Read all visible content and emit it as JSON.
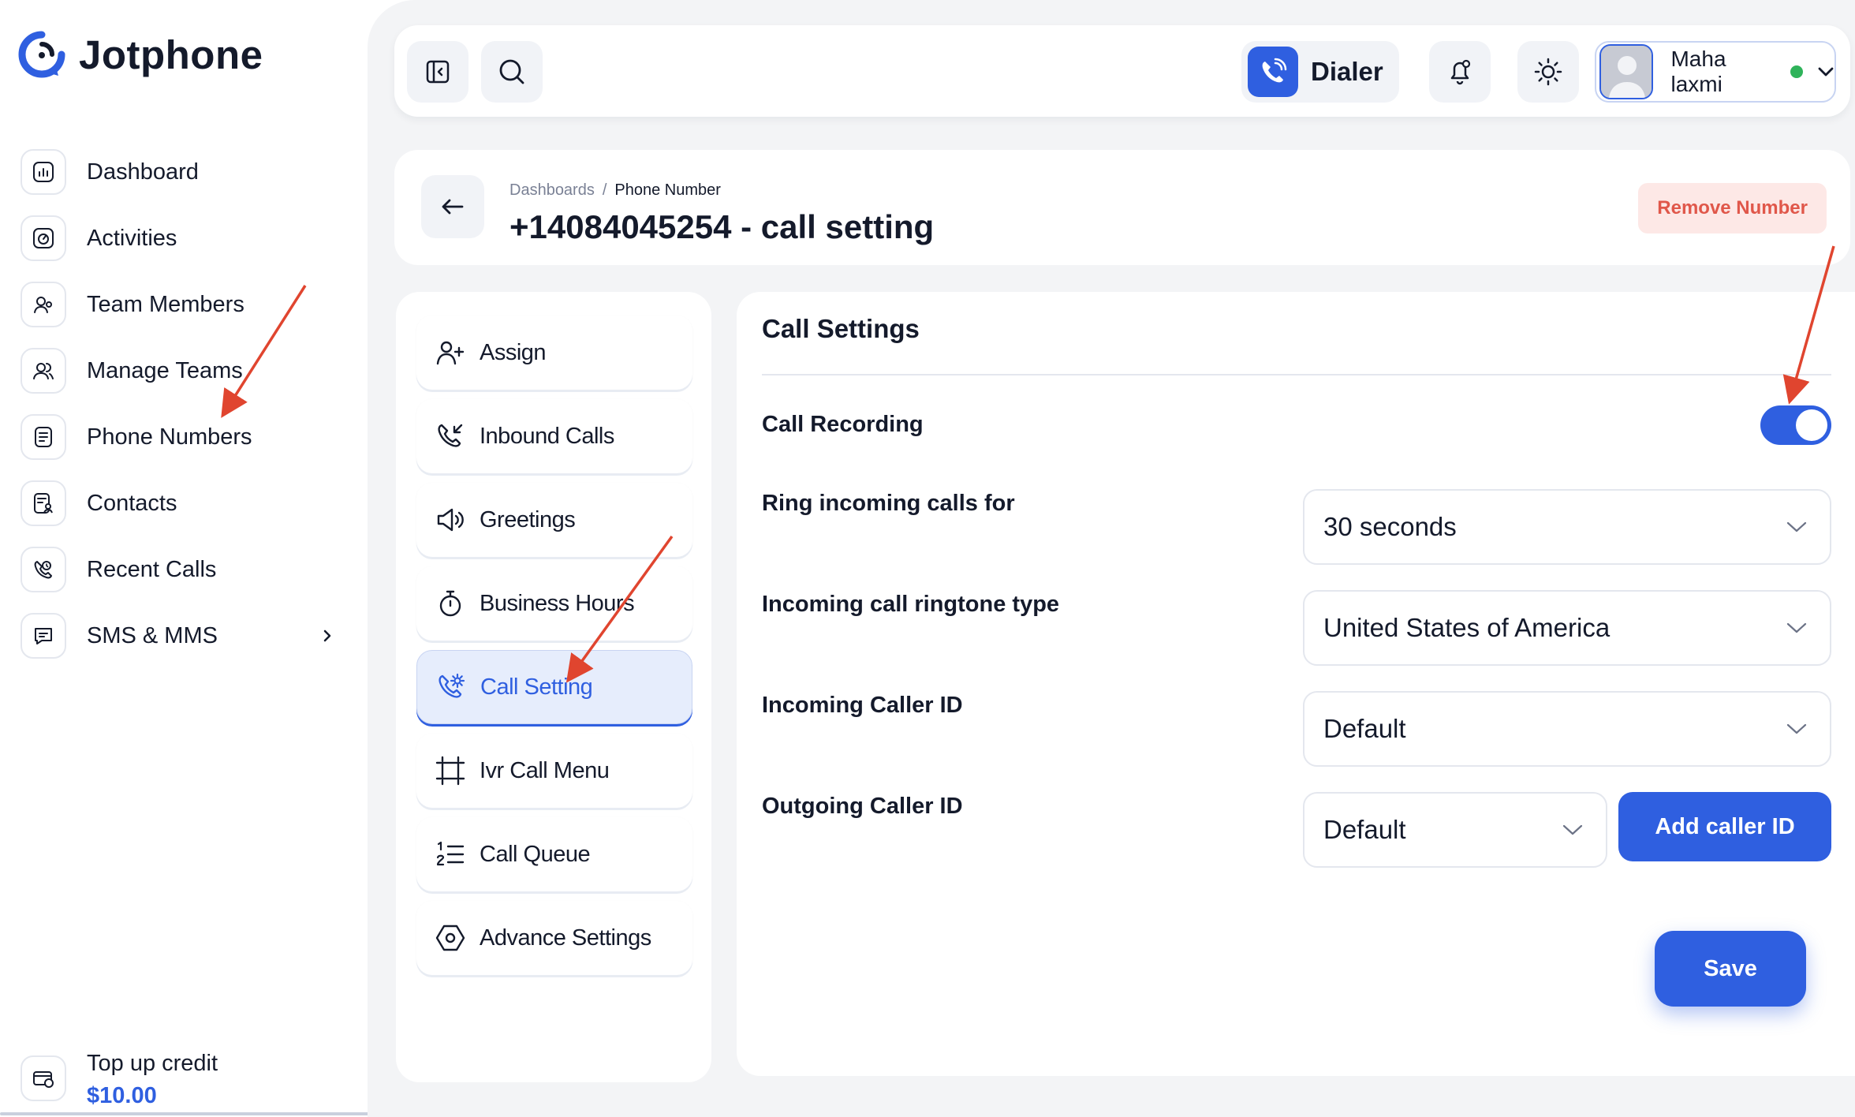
{
  "app": {
    "name": "Jotphone"
  },
  "sidebar": {
    "items": [
      {
        "label": "Dashboard",
        "icon": "chart-icon"
      },
      {
        "label": "Activities",
        "icon": "activity-icon"
      },
      {
        "label": "Team Members",
        "icon": "team-member-icon"
      },
      {
        "label": "Manage Teams",
        "icon": "teams-icon"
      },
      {
        "label": "Phone Numbers",
        "icon": "phone-book-icon"
      },
      {
        "label": "Contacts",
        "icon": "contacts-icon"
      },
      {
        "label": "Recent Calls",
        "icon": "recent-calls-icon"
      },
      {
        "label": "SMS & MMS",
        "icon": "message-icon"
      }
    ],
    "credit": {
      "label": "Top up credit",
      "value": "$10.00"
    }
  },
  "topbar": {
    "dialer_label": "Dialer",
    "user_name": "Maha laxmi",
    "status": "online"
  },
  "header": {
    "breadcrumb": [
      "Dashboards",
      "/",
      "Phone Number"
    ],
    "title": "+14084045254 - call setting",
    "remove_label": "Remove Number"
  },
  "submenu": {
    "items": [
      {
        "label": "Assign",
        "icon": "user-plus-icon"
      },
      {
        "label": "Inbound Calls",
        "icon": "inbound-call-icon"
      },
      {
        "label": "Greetings",
        "icon": "speaker-icon"
      },
      {
        "label": "Business Hours",
        "icon": "stopwatch-icon"
      },
      {
        "label": "Call Setting",
        "icon": "phone-settings-icon",
        "active": true
      },
      {
        "label": "Ivr Call Menu",
        "icon": "ivr-frame-icon"
      },
      {
        "label": "Call Queue",
        "icon": "numbered-list-icon"
      },
      {
        "label": "Advance Settings",
        "icon": "hexagon-settings-icon"
      }
    ]
  },
  "settings": {
    "title": "Call Settings",
    "call_recording": {
      "label": "Call Recording",
      "enabled": true
    },
    "ring_for": {
      "label": "Ring incoming calls for",
      "value": "30 seconds"
    },
    "ringtone": {
      "label": "Incoming call ringtone type",
      "value": "United States of America"
    },
    "incoming_caller_id": {
      "label": "Incoming Caller ID",
      "value": "Default"
    },
    "outgoing_caller_id": {
      "label": "Outgoing Caller ID",
      "value": "Default",
      "add_label": "Add caller ID"
    },
    "save_label": "Save"
  },
  "colors": {
    "accent": "#2f5fe0",
    "annotation": "#e0452f",
    "danger_bg": "#fde8e6",
    "danger_text": "#e0574a"
  }
}
